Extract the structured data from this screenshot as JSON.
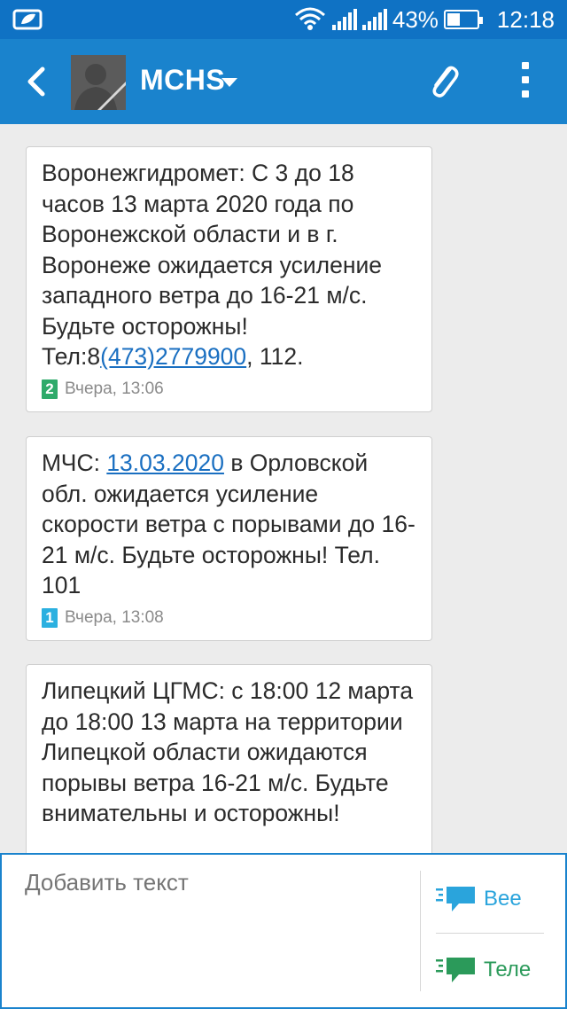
{
  "status_bar": {
    "battery_percent": "43%",
    "time": "12:18"
  },
  "app_bar": {
    "contact_name": "MCHS"
  },
  "messages": [
    {
      "parts": [
        {
          "text": "Воронежгидромет: С 3 до 18 часов 13 марта 2020 года по Воронежской области и в г. Воронеже ожидается усиление западного ветра до 16-21 м/с. Будьте осторожны! Тел:8"
        },
        {
          "link": "(473)2779900"
        },
        {
          "text": ", 112."
        }
      ],
      "sim": "2",
      "timestamp": "Вчера, 13:06"
    },
    {
      "parts": [
        {
          "text": "МЧС: "
        },
        {
          "link": "13.03.2020"
        },
        {
          "text": " в Орловской обл. ожидается усиление скорости ветра с порывами до 16-21 м/с. Будьте осторожны! Тел. 101"
        }
      ],
      "sim": "1",
      "timestamp": "Вчера, 13:08"
    },
    {
      "parts": [
        {
          "text": "Липецкий ЦГМС: с 18:00 12 марта до 18:00 13 марта на территории Липецкой области ожидаются порывы ветра 16-21 м/с. Будьте внимательны и осторожны!"
        }
      ]
    }
  ],
  "compose": {
    "placeholder": "Добавить текст",
    "send_sim1_label": "Вее",
    "send_sim2_label": "Теле"
  },
  "colors": {
    "status_bar": "#0f72c4",
    "app_bar": "#1a83cd",
    "link": "#1a6fc1",
    "sim1": "#2bb0e0",
    "sim2": "#2eaa6a"
  }
}
